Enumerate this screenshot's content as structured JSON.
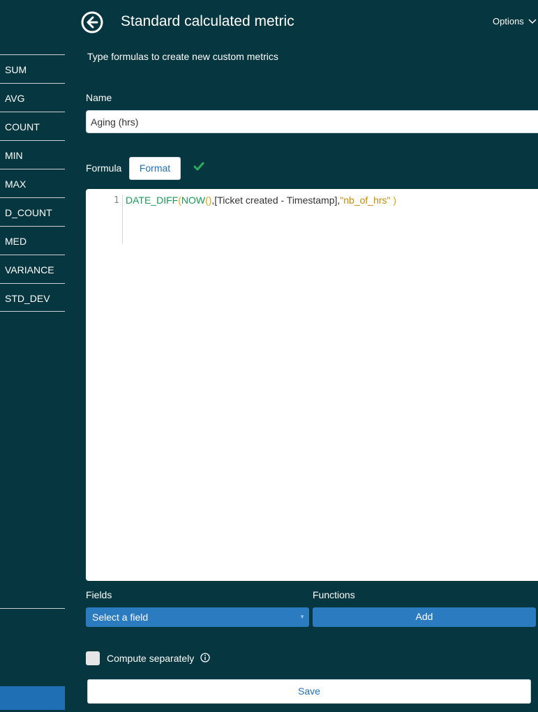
{
  "header": {
    "title": "Standard calculated metric",
    "options_label": "Options",
    "subtitle": "Type formulas to create new custom metrics"
  },
  "sidebar": {
    "items": [
      {
        "label": "SUM"
      },
      {
        "label": "AVG"
      },
      {
        "label": "COUNT"
      },
      {
        "label": "MIN"
      },
      {
        "label": "MAX"
      },
      {
        "label": "D_COUNT"
      },
      {
        "label": "MED"
      },
      {
        "label": "VARIANCE"
      },
      {
        "label": "STD_DEV"
      }
    ]
  },
  "name": {
    "label": "Name",
    "value": "Aging (hrs)"
  },
  "formula": {
    "label": "Formula",
    "format_label": "Format",
    "line_number": "1",
    "tokens": {
      "fn1": "DATE_DIFF",
      "p1": "(",
      "fn2": "NOW",
      "p2": "()",
      "text": ",[Ticket created - Timestamp],",
      "str": "\"nb_of_hrs\"",
      "p3": " )"
    }
  },
  "fields": {
    "label": "Fields",
    "select_label": "Select a field"
  },
  "functions": {
    "label": "Functions",
    "add_label": "Add"
  },
  "compute": {
    "label": "Compute separately"
  },
  "save_label": "Save",
  "colors": {
    "background": "#06363f",
    "accent": "#1f6fb5",
    "valid_check": "#27ae60"
  },
  "icons": {
    "back": "arrow-left-circle",
    "options": "chevron-down",
    "check": "check",
    "info": "info-circle"
  }
}
